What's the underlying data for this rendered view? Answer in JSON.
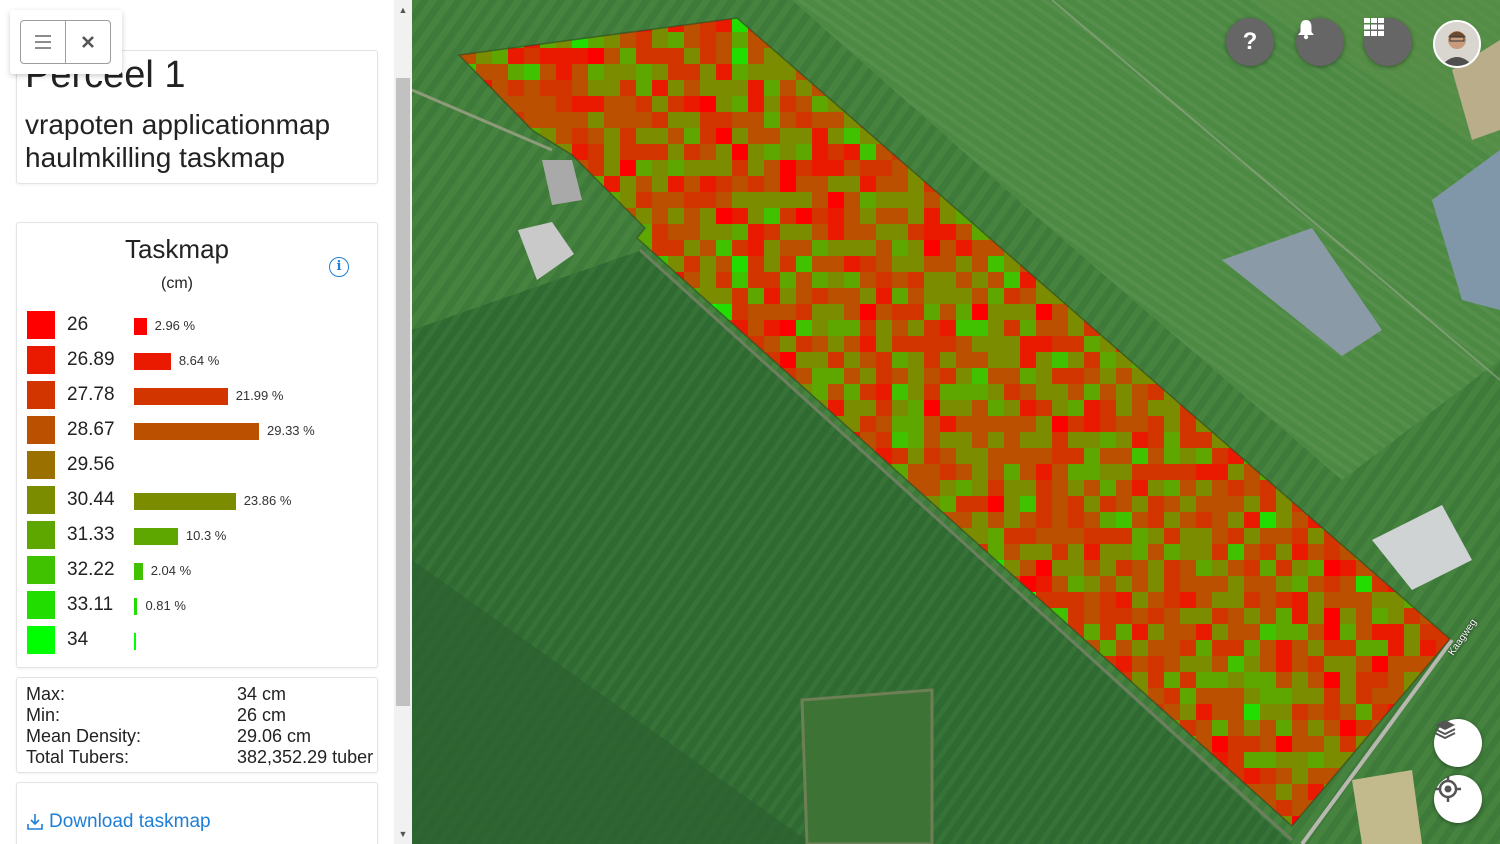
{
  "toolbar": {
    "menu_icon": "menu-icon",
    "close_icon": "close-icon"
  },
  "field": {
    "name": "Perceel 1",
    "subtitles": [
      "vrapoten applicationmap",
      "haulmkilling taskmap"
    ]
  },
  "legend": {
    "title": "Taskmap",
    "unit": "(cm)",
    "info_icon": "info-icon",
    "classes": [
      {
        "value": "26",
        "color": "#ff0000",
        "percent": 2.96,
        "label": "2.96 %"
      },
      {
        "value": "26.89",
        "color": "#e91a00",
        "percent": 8.64,
        "label": "8.64 %"
      },
      {
        "value": "27.78",
        "color": "#d23500",
        "percent": 21.99,
        "label": "21.99 %"
      },
      {
        "value": "28.67",
        "color": "#ba5000",
        "percent": 29.33,
        "label": "29.33 %"
      },
      {
        "value": "29.56",
        "color": "#9a7100",
        "percent": 0,
        "label": ""
      },
      {
        "value": "30.44",
        "color": "#7c8c00",
        "percent": 23.86,
        "label": "23.86 %"
      },
      {
        "value": "31.33",
        "color": "#5ea700",
        "percent": 10.3,
        "label": "10.3 %"
      },
      {
        "value": "32.22",
        "color": "#40c200",
        "percent": 2.04,
        "label": "2.04 %"
      },
      {
        "value": "33.11",
        "color": "#22de00",
        "percent": 0.81,
        "label": "0.81 %"
      },
      {
        "value": "34",
        "color": "#00ff00",
        "percent": 0.1,
        "label": ""
      }
    ]
  },
  "stats": [
    {
      "label": "Max:",
      "value": "34 cm"
    },
    {
      "label": "Min:",
      "value": "26 cm"
    },
    {
      "label": "Mean Density:",
      "value": "29.06 cm"
    },
    {
      "label": "Total Tubers:",
      "value": "382,352.29 tuber"
    }
  ],
  "download": {
    "label": "Download taskmap",
    "icon": "download-icon"
  },
  "map": {
    "road_label": "Kaagweg",
    "buttons": {
      "help": "?",
      "help_icon": "question-icon",
      "bell_icon": "bell-icon",
      "apps_icon": "grid-icon",
      "avatar_icon": "user-avatar",
      "layers_icon": "layers-icon",
      "locate_icon": "locate-icon"
    }
  }
}
